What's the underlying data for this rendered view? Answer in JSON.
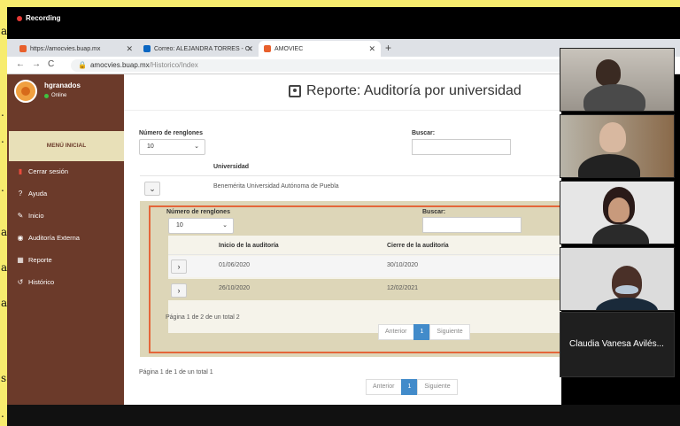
{
  "recording": {
    "label": "Recording"
  },
  "left_chars": [
    "a",
    ".",
    ".",
    ".",
    "a",
    "a",
    "a",
    "s",
    "."
  ],
  "browser": {
    "tabs": [
      {
        "label": "https://amocvies.buap.mx",
        "color": "#e8602c"
      },
      {
        "label": "Correo: ALEJANDRA TORRES - C:",
        "color": "#0a66c2"
      },
      {
        "label": "AMOVIEC",
        "color": "#e8602c"
      }
    ],
    "url_host": "amocvies.buap.mx",
    "url_path": "/Historico/Index"
  },
  "sidebar": {
    "username": "hgranados",
    "status": "Online",
    "menu_header": "MENÚ INICIAL",
    "items": [
      {
        "label": "Cerrar sesión",
        "icon": "logout-icon",
        "glyph": "▮",
        "color": "#e84b3c"
      },
      {
        "label": "Ayuda",
        "icon": "help-icon",
        "glyph": "?"
      },
      {
        "label": "Inicio",
        "icon": "edit-icon",
        "glyph": "✎"
      },
      {
        "label": "Auditoría Externa",
        "icon": "eye-icon",
        "glyph": "◉"
      },
      {
        "label": "Reporte",
        "icon": "report-icon",
        "glyph": "▦"
      },
      {
        "label": "Histórico",
        "icon": "history-icon",
        "glyph": "↺"
      }
    ]
  },
  "main": {
    "title": "Reporte: Auditoría por universidad",
    "rows_label": "Número de renglones",
    "rows_value": "10",
    "search_label": "Buscar:",
    "column_header": "Universidad",
    "university": "Benemérita Universidad Autónoma de Puebla",
    "footer": "Página 1 de 1 de un total 1",
    "pager": {
      "prev": "Anterior",
      "page": "1",
      "next": "Siguiente"
    }
  },
  "nested": {
    "rows_label": "Número de renglones",
    "rows_value": "10",
    "search_label": "Buscar:",
    "col_start": "Inicio de la auditoría",
    "col_end": "Cierre de la auditoría",
    "rows": [
      {
        "start": "01/06/2020",
        "end": "30/10/2020"
      },
      {
        "start": "26/10/2020",
        "end": "12/02/2021"
      }
    ],
    "footer": "Página 1 de 2 de un total 2",
    "pager": {
      "prev": "Anterior",
      "page": "1",
      "next": "Siguiente"
    }
  },
  "participants": {
    "name_tile": "Claudia Vanesa Avilés..."
  }
}
